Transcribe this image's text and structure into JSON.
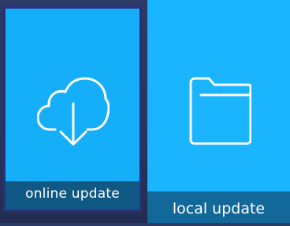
{
  "tiles": [
    {
      "label": "online update",
      "icon": "cloud-download-icon",
      "selected": true,
      "bg_color": "#15aef8",
      "label_bar_color": "#115985",
      "border_color": "#2a2f7e"
    },
    {
      "label": "local update",
      "icon": "folder-icon",
      "selected": false,
      "bg_color": "#1bb4ff",
      "label_bar_color": "#13689a"
    }
  ],
  "colors": {
    "background": "#2a3561",
    "icon_stroke": "#ffffff",
    "label_text": "#ffffff"
  }
}
